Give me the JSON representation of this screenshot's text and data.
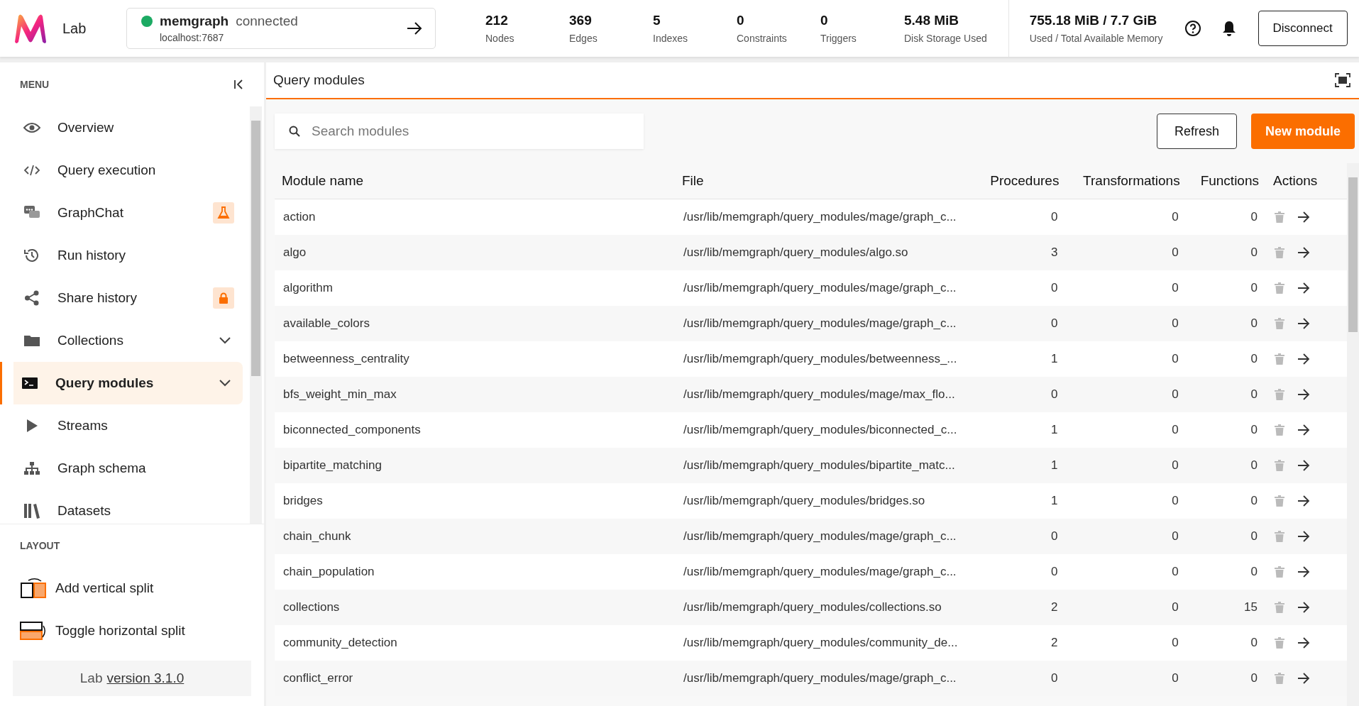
{
  "app": {
    "name": "Lab"
  },
  "connection": {
    "name": "memgraph",
    "status": "connected",
    "host": "localhost:7687"
  },
  "stats": [
    {
      "value": "212",
      "label": "Nodes"
    },
    {
      "value": "369",
      "label": "Edges"
    },
    {
      "value": "5",
      "label": "Indexes"
    },
    {
      "value": "0",
      "label": "Constraints"
    },
    {
      "value": "0",
      "label": "Triggers"
    },
    {
      "value": "5.48 MiB",
      "label": "Disk Storage Used"
    }
  ],
  "memory": {
    "value": "755.18 MiB / 7.7 GiB",
    "label": "Used / Total Available Memory"
  },
  "disconnect_button": "Disconnect",
  "sidebar": {
    "menu_heading": "MENU",
    "items": [
      {
        "label": "Overview",
        "selected": false,
        "badge": false,
        "submenu": false
      },
      {
        "label": "Query execution",
        "selected": false,
        "badge": false,
        "submenu": false
      },
      {
        "label": "GraphChat",
        "selected": false,
        "badge": true,
        "submenu": false
      },
      {
        "label": "Run history",
        "selected": false,
        "badge": false,
        "submenu": false
      },
      {
        "label": "Share history",
        "selected": false,
        "badge": true,
        "submenu": false
      },
      {
        "label": "Collections",
        "selected": false,
        "badge": false,
        "submenu": true
      },
      {
        "label": "Query modules",
        "selected": true,
        "badge": false,
        "submenu": true
      },
      {
        "label": "Streams",
        "selected": false,
        "badge": false,
        "submenu": false
      },
      {
        "label": "Graph schema",
        "selected": false,
        "badge": false,
        "submenu": false
      },
      {
        "label": "Datasets",
        "selected": false,
        "badge": false,
        "submenu": false
      }
    ],
    "layout_heading": "LAYOUT",
    "layout_items": [
      "Add vertical split",
      "Toggle horizontal split"
    ],
    "footer": {
      "text": "Lab",
      "link": "version 3.1.0"
    }
  },
  "panel": {
    "title": "Query modules",
    "search": {
      "placeholder": "Search modules"
    },
    "buttons": {
      "refresh": "Refresh",
      "new": "New module"
    },
    "table": {
      "columns": [
        "Module name",
        "File",
        "Procedures",
        "Transformations",
        "Functions",
        "Actions"
      ],
      "rows": [
        {
          "name": "action",
          "file": "/usr/lib/memgraph/query_modules/mage/graph_c...",
          "procedures": "0",
          "transformations": "0",
          "functions": "0"
        },
        {
          "name": "algo",
          "file": "/usr/lib/memgraph/query_modules/algo.so",
          "procedures": "3",
          "transformations": "0",
          "functions": "0"
        },
        {
          "name": "algorithm",
          "file": "/usr/lib/memgraph/query_modules/mage/graph_c...",
          "procedures": "0",
          "transformations": "0",
          "functions": "0"
        },
        {
          "name": "available_colors",
          "file": "/usr/lib/memgraph/query_modules/mage/graph_c...",
          "procedures": "0",
          "transformations": "0",
          "functions": "0"
        },
        {
          "name": "betweenness_centrality",
          "file": "/usr/lib/memgraph/query_modules/betweenness_...",
          "procedures": "1",
          "transformations": "0",
          "functions": "0"
        },
        {
          "name": "bfs_weight_min_max",
          "file": "/usr/lib/memgraph/query_modules/mage/max_flo...",
          "procedures": "0",
          "transformations": "0",
          "functions": "0"
        },
        {
          "name": "biconnected_components",
          "file": "/usr/lib/memgraph/query_modules/biconnected_c...",
          "procedures": "1",
          "transformations": "0",
          "functions": "0"
        },
        {
          "name": "bipartite_matching",
          "file": "/usr/lib/memgraph/query_modules/bipartite_matc...",
          "procedures": "1",
          "transformations": "0",
          "functions": "0"
        },
        {
          "name": "bridges",
          "file": "/usr/lib/memgraph/query_modules/bridges.so",
          "procedures": "1",
          "transformations": "0",
          "functions": "0"
        },
        {
          "name": "chain_chunk",
          "file": "/usr/lib/memgraph/query_modules/mage/graph_c...",
          "procedures": "0",
          "transformations": "0",
          "functions": "0"
        },
        {
          "name": "chain_population",
          "file": "/usr/lib/memgraph/query_modules/mage/graph_c...",
          "procedures": "0",
          "transformations": "0",
          "functions": "0"
        },
        {
          "name": "collections",
          "file": "/usr/lib/memgraph/query_modules/collections.so",
          "procedures": "2",
          "transformations": "0",
          "functions": "15"
        },
        {
          "name": "community_detection",
          "file": "/usr/lib/memgraph/query_modules/community_de...",
          "procedures": "2",
          "transformations": "0",
          "functions": "0"
        },
        {
          "name": "conflict_error",
          "file": "/usr/lib/memgraph/query_modules/mage/graph_c...",
          "procedures": "0",
          "transformations": "0",
          "functions": "0"
        }
      ]
    }
  }
}
